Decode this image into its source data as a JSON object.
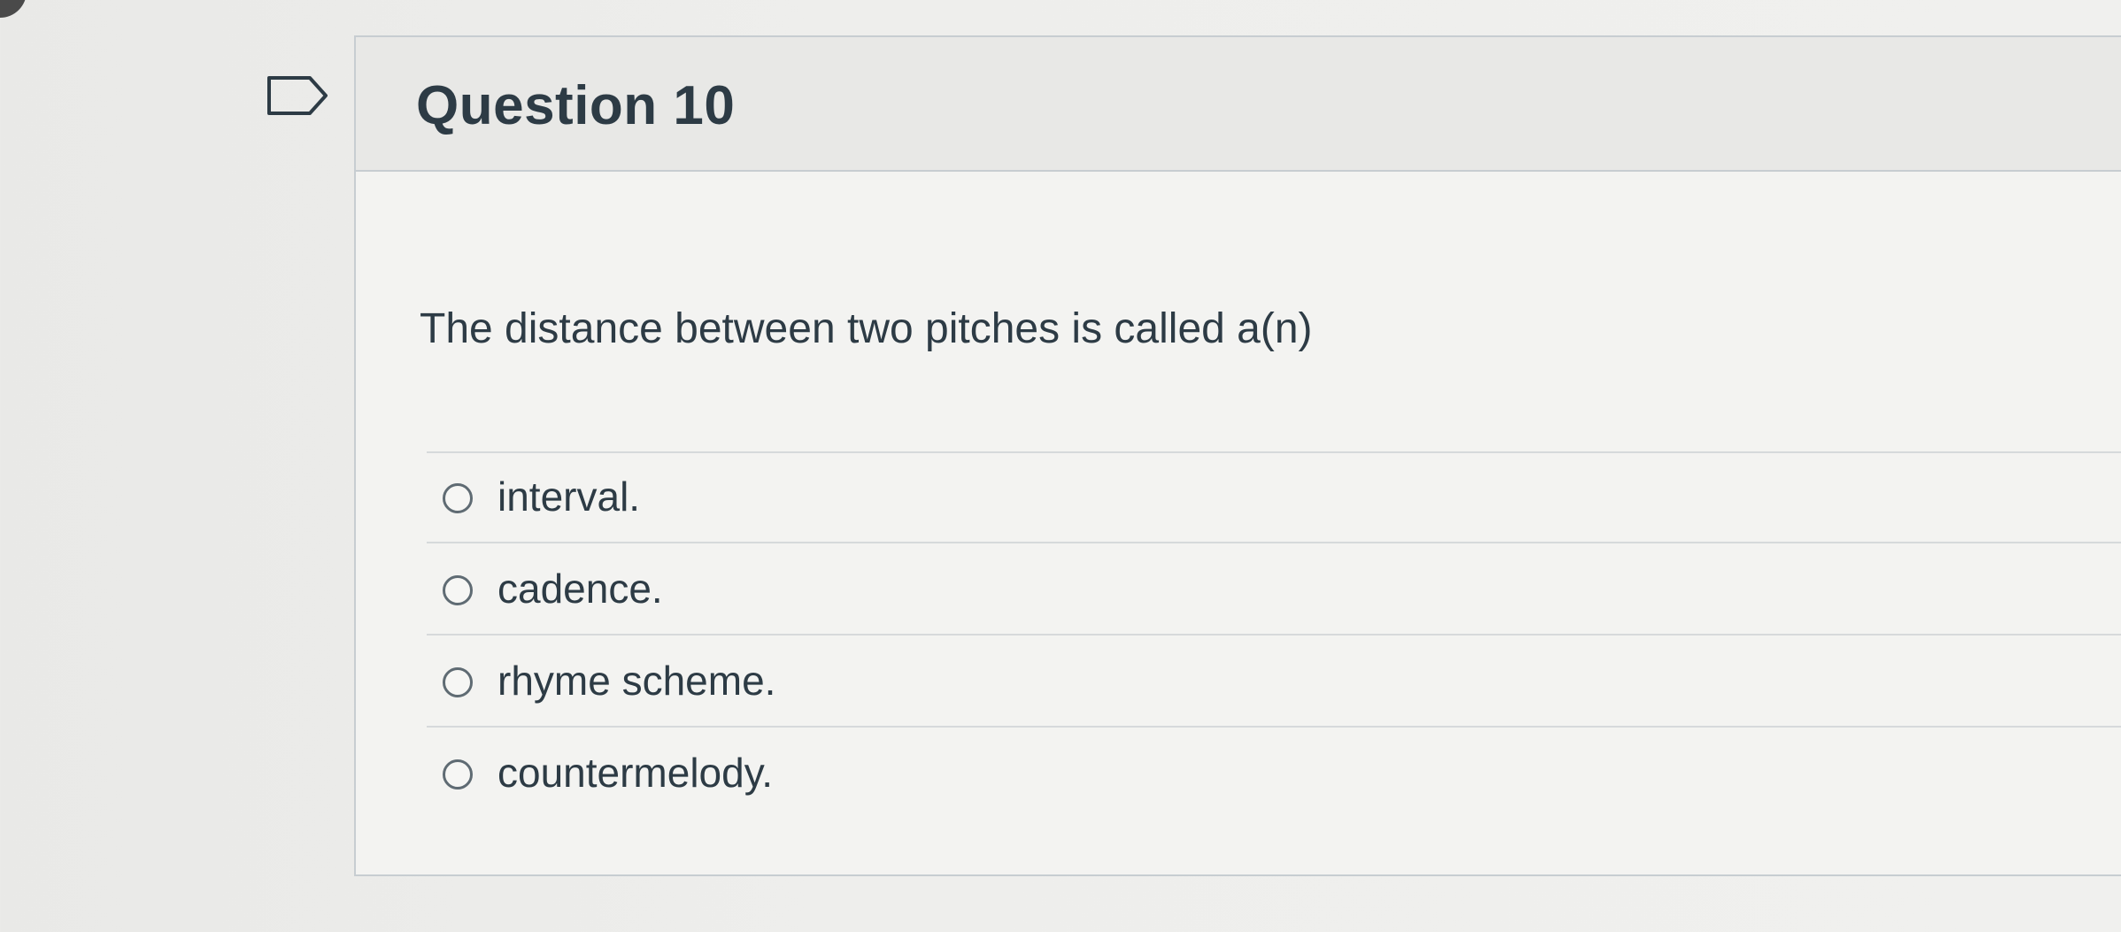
{
  "question": {
    "title": "Question 10",
    "text": "The distance between two pitches is called a(n)",
    "answers": [
      {
        "label": "interval."
      },
      {
        "label": "cadence."
      },
      {
        "label": "rhyme scheme."
      },
      {
        "label": "countermelody."
      }
    ]
  },
  "icons": {
    "flag": "flag-icon",
    "radio": "radio-icon"
  },
  "colors": {
    "text": "#2d3b45",
    "border": "#c7cdd1",
    "header_bg": "#e8e8e6",
    "body_bg": "#f3f3f1"
  }
}
